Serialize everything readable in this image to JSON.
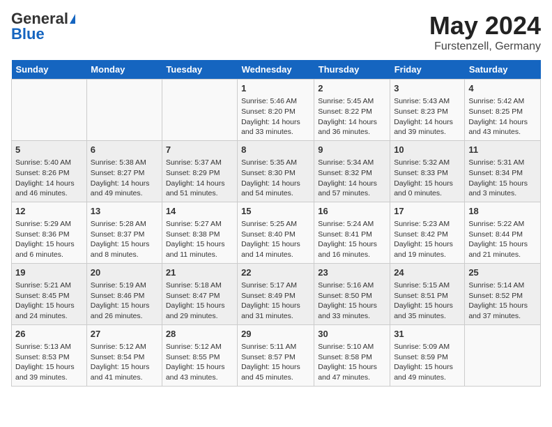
{
  "header": {
    "logo_general": "General",
    "logo_blue": "Blue",
    "title": "May 2024",
    "subtitle": "Furstenzell, Germany"
  },
  "days_of_week": [
    "Sunday",
    "Monday",
    "Tuesday",
    "Wednesday",
    "Thursday",
    "Friday",
    "Saturday"
  ],
  "weeks": [
    [
      {
        "day": "",
        "info": ""
      },
      {
        "day": "",
        "info": ""
      },
      {
        "day": "",
        "info": ""
      },
      {
        "day": "1",
        "info": "Sunrise: 5:46 AM\nSunset: 8:20 PM\nDaylight: 14 hours and 33 minutes."
      },
      {
        "day": "2",
        "info": "Sunrise: 5:45 AM\nSunset: 8:22 PM\nDaylight: 14 hours and 36 minutes."
      },
      {
        "day": "3",
        "info": "Sunrise: 5:43 AM\nSunset: 8:23 PM\nDaylight: 14 hours and 39 minutes."
      },
      {
        "day": "4",
        "info": "Sunrise: 5:42 AM\nSunset: 8:25 PM\nDaylight: 14 hours and 43 minutes."
      }
    ],
    [
      {
        "day": "5",
        "info": "Sunrise: 5:40 AM\nSunset: 8:26 PM\nDaylight: 14 hours and 46 minutes."
      },
      {
        "day": "6",
        "info": "Sunrise: 5:38 AM\nSunset: 8:27 PM\nDaylight: 14 hours and 49 minutes."
      },
      {
        "day": "7",
        "info": "Sunrise: 5:37 AM\nSunset: 8:29 PM\nDaylight: 14 hours and 51 minutes."
      },
      {
        "day": "8",
        "info": "Sunrise: 5:35 AM\nSunset: 8:30 PM\nDaylight: 14 hours and 54 minutes."
      },
      {
        "day": "9",
        "info": "Sunrise: 5:34 AM\nSunset: 8:32 PM\nDaylight: 14 hours and 57 minutes."
      },
      {
        "day": "10",
        "info": "Sunrise: 5:32 AM\nSunset: 8:33 PM\nDaylight: 15 hours and 0 minutes."
      },
      {
        "day": "11",
        "info": "Sunrise: 5:31 AM\nSunset: 8:34 PM\nDaylight: 15 hours and 3 minutes."
      }
    ],
    [
      {
        "day": "12",
        "info": "Sunrise: 5:29 AM\nSunset: 8:36 PM\nDaylight: 15 hours and 6 minutes."
      },
      {
        "day": "13",
        "info": "Sunrise: 5:28 AM\nSunset: 8:37 PM\nDaylight: 15 hours and 8 minutes."
      },
      {
        "day": "14",
        "info": "Sunrise: 5:27 AM\nSunset: 8:38 PM\nDaylight: 15 hours and 11 minutes."
      },
      {
        "day": "15",
        "info": "Sunrise: 5:25 AM\nSunset: 8:40 PM\nDaylight: 15 hours and 14 minutes."
      },
      {
        "day": "16",
        "info": "Sunrise: 5:24 AM\nSunset: 8:41 PM\nDaylight: 15 hours and 16 minutes."
      },
      {
        "day": "17",
        "info": "Sunrise: 5:23 AM\nSunset: 8:42 PM\nDaylight: 15 hours and 19 minutes."
      },
      {
        "day": "18",
        "info": "Sunrise: 5:22 AM\nSunset: 8:44 PM\nDaylight: 15 hours and 21 minutes."
      }
    ],
    [
      {
        "day": "19",
        "info": "Sunrise: 5:21 AM\nSunset: 8:45 PM\nDaylight: 15 hours and 24 minutes."
      },
      {
        "day": "20",
        "info": "Sunrise: 5:19 AM\nSunset: 8:46 PM\nDaylight: 15 hours and 26 minutes."
      },
      {
        "day": "21",
        "info": "Sunrise: 5:18 AM\nSunset: 8:47 PM\nDaylight: 15 hours and 29 minutes."
      },
      {
        "day": "22",
        "info": "Sunrise: 5:17 AM\nSunset: 8:49 PM\nDaylight: 15 hours and 31 minutes."
      },
      {
        "day": "23",
        "info": "Sunrise: 5:16 AM\nSunset: 8:50 PM\nDaylight: 15 hours and 33 minutes."
      },
      {
        "day": "24",
        "info": "Sunrise: 5:15 AM\nSunset: 8:51 PM\nDaylight: 15 hours and 35 minutes."
      },
      {
        "day": "25",
        "info": "Sunrise: 5:14 AM\nSunset: 8:52 PM\nDaylight: 15 hours and 37 minutes."
      }
    ],
    [
      {
        "day": "26",
        "info": "Sunrise: 5:13 AM\nSunset: 8:53 PM\nDaylight: 15 hours and 39 minutes."
      },
      {
        "day": "27",
        "info": "Sunrise: 5:12 AM\nSunset: 8:54 PM\nDaylight: 15 hours and 41 minutes."
      },
      {
        "day": "28",
        "info": "Sunrise: 5:12 AM\nSunset: 8:55 PM\nDaylight: 15 hours and 43 minutes."
      },
      {
        "day": "29",
        "info": "Sunrise: 5:11 AM\nSunset: 8:57 PM\nDaylight: 15 hours and 45 minutes."
      },
      {
        "day": "30",
        "info": "Sunrise: 5:10 AM\nSunset: 8:58 PM\nDaylight: 15 hours and 47 minutes."
      },
      {
        "day": "31",
        "info": "Sunrise: 5:09 AM\nSunset: 8:59 PM\nDaylight: 15 hours and 49 minutes."
      },
      {
        "day": "",
        "info": ""
      }
    ]
  ]
}
